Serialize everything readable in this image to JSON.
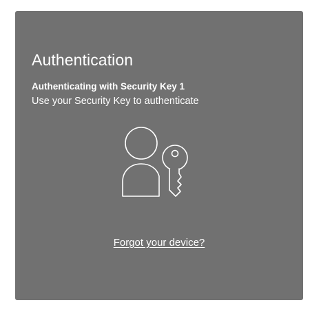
{
  "auth": {
    "title": "Authentication",
    "subtitle": "Authenticating with Security Key 1",
    "instruction": "Use your Security Key to authenticate",
    "forgot_link": "Forgot your device?",
    "illustration_icon": "user-with-key-icon"
  },
  "colors": {
    "card_background": "#717171",
    "text": "#ffffff",
    "page_background": "#ffffff"
  }
}
